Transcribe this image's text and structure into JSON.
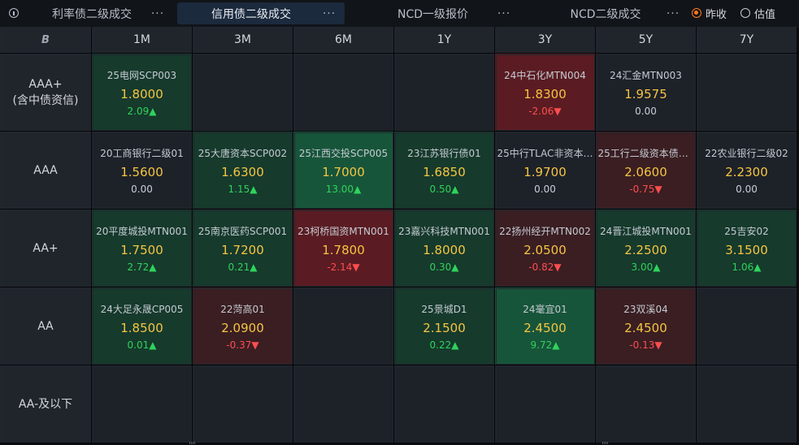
{
  "tabs": [
    {
      "label": "利率债二级成交",
      "active": false
    },
    {
      "label": "信用债二级成交",
      "active": true
    },
    {
      "label": "NCD一级报价",
      "active": false
    },
    {
      "label": "NCD二级成交",
      "active": false
    }
  ],
  "more_label": "···",
  "radios": [
    {
      "label": "昨收",
      "selected": true
    },
    {
      "label": "估值",
      "selected": false
    }
  ],
  "corner_logo": "B",
  "columns": [
    "1M",
    "3M",
    "6M",
    "1Y",
    "3Y",
    "5Y",
    "7Y"
  ],
  "rows": [
    {
      "label": "AAA+\n(含中债资信)",
      "label_lines": [
        "AAA+",
        "(含中债资信)"
      ],
      "cells": [
        {
          "name": "25电网SCP003",
          "price": "1.8000",
          "change": "2.09",
          "dir": "up",
          "tone": "green"
        },
        null,
        null,
        null,
        {
          "name": "24中石化MTN004",
          "price": "1.8300",
          "change": "-2.06",
          "dir": "down",
          "tone": "red-strong"
        },
        {
          "name": "24汇金MTN003",
          "price": "1.9575",
          "change": "0.00",
          "dir": "flat",
          "tone": "dark"
        },
        null
      ]
    },
    {
      "label_lines": [
        "AAA"
      ],
      "cells": [
        {
          "name": "20工商银行二级01",
          "price": "1.5600",
          "change": "0.00",
          "dir": "flat",
          "tone": "dark"
        },
        {
          "name": "25大唐资本SCP002",
          "price": "1.6300",
          "change": "1.15",
          "dir": "up",
          "tone": "green"
        },
        {
          "name": "25江西交投SCP005",
          "price": "1.7000",
          "change": "13.00",
          "dir": "up",
          "tone": "green-strong"
        },
        {
          "name": "23江苏银行债01",
          "price": "1.6850",
          "change": "0.50",
          "dir": "up",
          "tone": "green"
        },
        {
          "name": "25中行TLAC非资本…",
          "price": "1.9700",
          "change": "0.00",
          "dir": "flat",
          "tone": "dark"
        },
        {
          "name": "25工行二级资本债0…",
          "price": "2.0600",
          "change": "-0.75",
          "dir": "down",
          "tone": "red"
        },
        {
          "name": "22农业银行二级02",
          "price": "2.2300",
          "change": "0.00",
          "dir": "flat",
          "tone": "dark"
        }
      ]
    },
    {
      "label_lines": [
        "AA+"
      ],
      "cells": [
        {
          "name": "20平度城投MTN001",
          "price": "1.7500",
          "change": "2.72",
          "dir": "up",
          "tone": "green"
        },
        {
          "name": "25南京医药SCP001",
          "price": "1.7200",
          "change": "0.21",
          "dir": "up",
          "tone": "green"
        },
        {
          "name": "23柯桥国资MTN001",
          "price": "1.7800",
          "change": "-2.14",
          "dir": "down",
          "tone": "red-strong"
        },
        {
          "name": "23嘉兴科技MTN001",
          "price": "1.8000",
          "change": "0.30",
          "dir": "up",
          "tone": "green"
        },
        {
          "name": "22扬州经开MTN002",
          "price": "2.0500",
          "change": "-0.82",
          "dir": "down",
          "tone": "red"
        },
        {
          "name": "24晋江城投MTN001",
          "price": "2.2500",
          "change": "3.00",
          "dir": "up",
          "tone": "green"
        },
        {
          "name": "25吉安02",
          "price": "3.1500",
          "change": "1.06",
          "dir": "up",
          "tone": "green"
        }
      ]
    },
    {
      "label_lines": [
        "AA"
      ],
      "cells": [
        {
          "name": "24大足永晟CP005",
          "price": "1.8500",
          "change": "0.01",
          "dir": "up",
          "tone": "green"
        },
        {
          "name": "22菏高01",
          "price": "2.0900",
          "change": "-0.37",
          "dir": "down",
          "tone": "red"
        },
        null,
        {
          "name": "25景城D1",
          "price": "2.1500",
          "change": "0.22",
          "dir": "up",
          "tone": "green"
        },
        {
          "name": "24毫宜01",
          "price": "2.4500",
          "change": "9.72",
          "dir": "up",
          "tone": "green-strong"
        },
        {
          "name": "23双溪04",
          "price": "2.4500",
          "change": "-0.13",
          "dir": "down",
          "tone": "red"
        },
        null
      ]
    },
    {
      "label_lines": [
        "AA-及以下"
      ],
      "cells": [
        null,
        null,
        null,
        null,
        null,
        null,
        null
      ]
    }
  ],
  "arrows": {
    "up": "▲",
    "down": "▼"
  },
  "colors": {
    "price": "#f5c542",
    "up": "#2fd35b",
    "down": "#ff4d4f",
    "radio_selected": "#ff7a1a",
    "active_tab": "#1b2a3d"
  }
}
